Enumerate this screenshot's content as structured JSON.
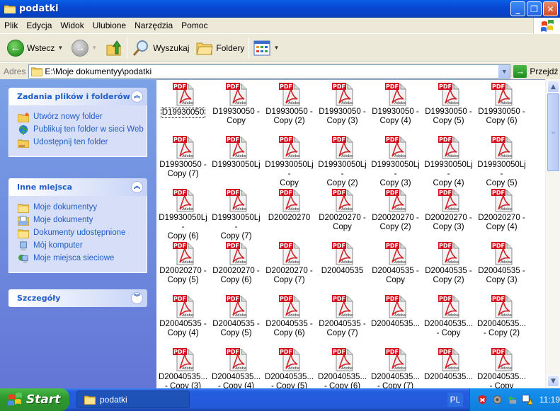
{
  "window": {
    "title": "podatki",
    "buttons": {
      "minimize": "_",
      "restore": "❐",
      "close": "✕"
    }
  },
  "menu": [
    "Plik",
    "Edycja",
    "Widok",
    "Ulubione",
    "Narzędzia",
    "Pomoc"
  ],
  "toolbar": {
    "back_label": "Wstecz",
    "search_label": "Wyszukaj",
    "folders_label": "Foldery"
  },
  "address": {
    "label": "Adres",
    "value": "E:\\Moje dokumentyy\\podatki",
    "go_label": "Przejdź"
  },
  "left_pane": {
    "tasks": {
      "title": "Zadania plików i folderów",
      "items": [
        {
          "label": "Utwórz nowy folder",
          "icon": "new-folder-icon"
        },
        {
          "label": "Publikuj ten folder w sieci Web",
          "icon": "publish-web-icon"
        },
        {
          "label": "Udostępnij ten folder",
          "icon": "share-folder-icon"
        }
      ]
    },
    "other_places": {
      "title": "Inne miejsca",
      "items": [
        {
          "label": "Moje dokumentyy",
          "icon": "folder-icon"
        },
        {
          "label": "Moje dokumenty",
          "icon": "my-documents-icon"
        },
        {
          "label": "Dokumenty udostępnione",
          "icon": "folder-icon"
        },
        {
          "label": "Mój komputer",
          "icon": "computer-icon"
        },
        {
          "label": "Moje miejsca sieciowe",
          "icon": "network-icon"
        }
      ]
    },
    "details": {
      "title": "Szczegóły"
    }
  },
  "files": [
    {
      "name": "D19930050",
      "selected": true
    },
    {
      "name": "D19930050 -\nCopy"
    },
    {
      "name": "D19930050 -\nCopy (2)"
    },
    {
      "name": "D19930050 -\nCopy (3)"
    },
    {
      "name": "D19930050 -\nCopy (4)"
    },
    {
      "name": "D19930050 -\nCopy (5)"
    },
    {
      "name": "D19930050 -\nCopy (6)"
    },
    {
      "name": "D19930050 -\nCopy (7)"
    },
    {
      "name": "D19930050Lj"
    },
    {
      "name": "D19930050Lj -\nCopy"
    },
    {
      "name": "D19930050Lj -\nCopy (2)"
    },
    {
      "name": "D19930050Lj -\nCopy (3)"
    },
    {
      "name": "D19930050Lj -\nCopy (4)"
    },
    {
      "name": "D19930050Lj -\nCopy (5)"
    },
    {
      "name": "D19930050Lj -\nCopy (6)"
    },
    {
      "name": "D19930050Lj -\nCopy (7)"
    },
    {
      "name": "D20020270"
    },
    {
      "name": "D20020270 -\nCopy"
    },
    {
      "name": "D20020270 -\nCopy (2)"
    },
    {
      "name": "D20020270 -\nCopy (3)"
    },
    {
      "name": "D20020270 -\nCopy (4)"
    },
    {
      "name": "D20020270 -\nCopy (5)"
    },
    {
      "name": "D20020270 -\nCopy (6)"
    },
    {
      "name": "D20020270 -\nCopy (7)"
    },
    {
      "name": "D20040535"
    },
    {
      "name": "D20040535 -\nCopy"
    },
    {
      "name": "D20040535 -\nCopy (2)"
    },
    {
      "name": "D20040535 -\nCopy (3)"
    },
    {
      "name": "D20040535 -\nCopy (4)"
    },
    {
      "name": "D20040535 -\nCopy (5)"
    },
    {
      "name": "D20040535 -\nCopy (6)"
    },
    {
      "name": "D20040535 -\nCopy (7)"
    },
    {
      "name": "D20040535..."
    },
    {
      "name": "D20040535...\n- Copy"
    },
    {
      "name": "D20040535...\n- Copy (2)"
    },
    {
      "name": "D20040535...\n- Copy (3)"
    },
    {
      "name": "D20040535...\n- Copy (4)"
    },
    {
      "name": "D20040535...\n- Copy (5)"
    },
    {
      "name": "D20040535...\n- Copy (6)"
    },
    {
      "name": "D20040535...\n- Copy (7)"
    },
    {
      "name": "D20040535..."
    },
    {
      "name": "D20040535...\n- Copy"
    }
  ],
  "file_icon": {
    "badge": "PDF",
    "brand": "Adobe"
  },
  "taskbar": {
    "start_label": "Start",
    "task_label": "podatki",
    "language": "PL",
    "clock": "11:19"
  }
}
